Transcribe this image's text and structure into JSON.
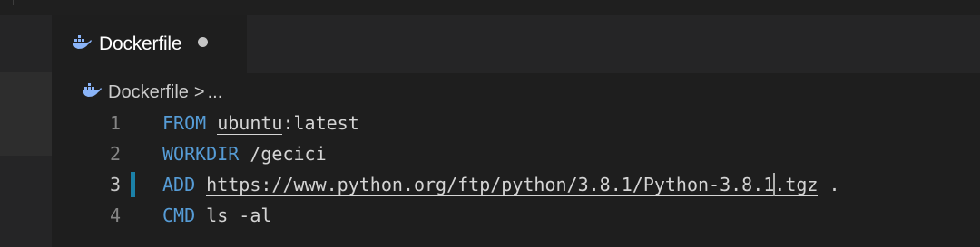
{
  "tab": {
    "label": "Dockerfile",
    "icon": "docker-whale-icon"
  },
  "breadcrumb": {
    "file": "Dockerfile",
    "separator": ">",
    "ellipsis": "..."
  },
  "colors": {
    "keyword": "#569cd6",
    "text": "#d4d4d4",
    "line_number": "#858585",
    "docker_icon": "#8ab4f8",
    "modified_marker": "#1b81a8"
  },
  "code": {
    "lines": [
      {
        "number": "1",
        "keyword": "FROM",
        "pre": "",
        "underlined": "ubuntu",
        "post": ":latest"
      },
      {
        "number": "2",
        "keyword": "WORKDIR",
        "pre": "/gecici",
        "underlined": "",
        "post": ""
      },
      {
        "number": "3",
        "keyword": "ADD",
        "underlined_a": "https://www.python.org/ftp/python/3.8.1/Python-3.8.1",
        "underlined_b": ".tgz",
        "post": " ."
      },
      {
        "number": "4",
        "keyword": "CMD",
        "pre": "ls -al",
        "underlined": "",
        "post": ""
      }
    ]
  }
}
